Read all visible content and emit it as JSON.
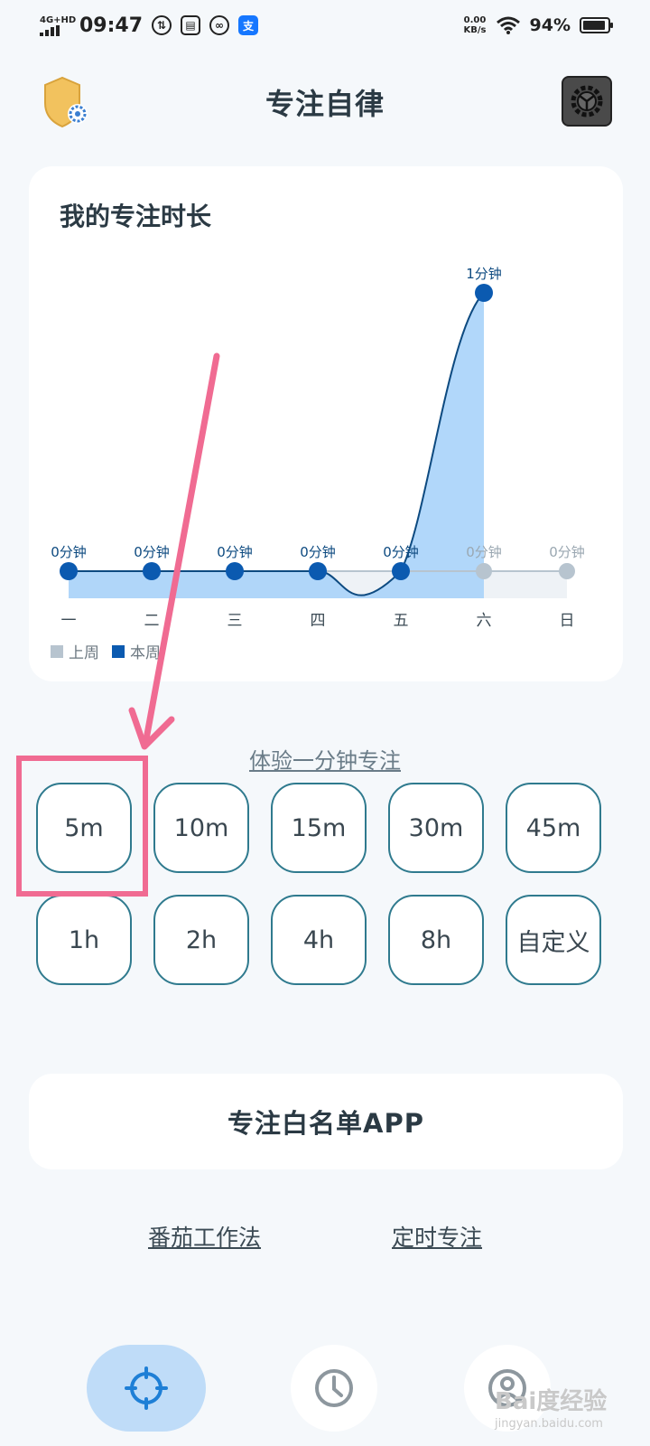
{
  "status_bar": {
    "network": "4G+HD",
    "time": "09:47",
    "icons": [
      "data-saver-icon",
      "sim-card-icon",
      "link-icon",
      "alipay-icon"
    ],
    "speed_value": "0.00",
    "speed_unit": "KB/s",
    "battery": "94%",
    "battery_level": 0.94
  },
  "header": {
    "title": "专注自律",
    "left_icon": "shield-gear-icon",
    "right_icon": "settings-gear-icon"
  },
  "chart_card": {
    "title": "我的专注时长"
  },
  "chart_data": {
    "type": "line",
    "categories": [
      "一",
      "二",
      "三",
      "四",
      "五",
      "六",
      "日"
    ],
    "series": [
      {
        "name": "上周",
        "values": [
          0,
          0,
          0,
          0,
          0,
          0,
          0
        ],
        "labels": [
          "0分钟",
          "0分钟",
          "0分钟",
          "0分钟",
          "0分钟",
          "0分钟",
          "0分钟"
        ],
        "color": "#b7c4cf"
      },
      {
        "name": "本周",
        "values": [
          0,
          0,
          0,
          0,
          0,
          1,
          null
        ],
        "labels": [
          "0分钟",
          "0分钟",
          "0分钟",
          "0分钟",
          "0分钟",
          "1分钟",
          ""
        ],
        "color": "#0b5ab0"
      }
    ],
    "ylim": [
      0,
      1
    ],
    "legend_position": "bottom-left",
    "grid": false
  },
  "trial_link": "体验一分钟专注",
  "durations": [
    [
      "5m",
      "10m",
      "15m",
      "30m",
      "45m"
    ],
    [
      "1h",
      "2h",
      "4h",
      "8h",
      "自定义"
    ]
  ],
  "whitelist_button": "专注白名单APP",
  "bottom_links": {
    "pomodoro": "番茄工作法",
    "timer": "定时专注"
  },
  "nav": [
    {
      "icon": "target-icon",
      "active": true
    },
    {
      "icon": "clock-icon",
      "active": false
    },
    {
      "icon": "user-icon",
      "active": false
    }
  ],
  "watermark": {
    "text": "Bai度经验",
    "sub": "jingyan.baidu.com"
  },
  "colors": {
    "accent": "#0b5ab0",
    "area": "#a8d3fa",
    "button_border": "#2f7a8e",
    "annotation": "#f06b92"
  }
}
